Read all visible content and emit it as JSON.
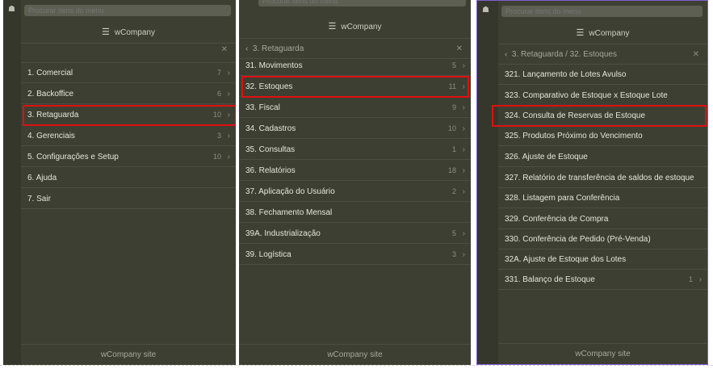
{
  "search_placeholder": "Procurar itens do menu",
  "brand": "wCompany",
  "footer": "wCompany site",
  "panel1": {
    "items": [
      {
        "label": "1. Comercial",
        "count": "7"
      },
      {
        "label": "2. Backoffice",
        "count": "6"
      },
      {
        "label": "3. Retaguarda",
        "count": "10"
      },
      {
        "label": "4. Gerenciais",
        "count": "3"
      },
      {
        "label": "5. Configurações e Setup",
        "count": "10"
      },
      {
        "label": "6. Ajuda",
        "count": ""
      },
      {
        "label": "7. Sair",
        "count": ""
      }
    ]
  },
  "panel2": {
    "search_partial": "Procurar itens do menu",
    "breadcrumb": "3. Retaguarda",
    "items": [
      {
        "label": "31. Movimentos",
        "count": "5"
      },
      {
        "label": "32. Estoques",
        "count": "11"
      },
      {
        "label": "33. Fiscal",
        "count": "9"
      },
      {
        "label": "34. Cadastros",
        "count": "10"
      },
      {
        "label": "35. Consultas",
        "count": "1"
      },
      {
        "label": "36. Relatórios",
        "count": "18"
      },
      {
        "label": "37. Aplicação do Usuário",
        "count": "2"
      },
      {
        "label": "38. Fechamento Mensal",
        "count": ""
      },
      {
        "label": "39A. Industrialização",
        "count": "5"
      },
      {
        "label": "39. Logística",
        "count": "3"
      }
    ]
  },
  "panel3": {
    "breadcrumb": "3. Retaguarda / 32. Estoques",
    "items": [
      {
        "label": "321. Lançamento de Lotes Avulso",
        "count": ""
      },
      {
        "label": "323. Comparativo de Estoque x Estoque Lote",
        "count": ""
      },
      {
        "label": "324. Consulta de Reservas de Estoque",
        "count": ""
      },
      {
        "label": "325. Produtos Próximo do Vencimento",
        "count": ""
      },
      {
        "label": "326. Ajuste de Estoque",
        "count": ""
      },
      {
        "label": "327. Relatório de transferência de saldos de estoque",
        "count": ""
      },
      {
        "label": "328. Listagem para Conferência",
        "count": ""
      },
      {
        "label": "329. Conferência de Compra",
        "count": ""
      },
      {
        "label": "330. Conferência de Pedido (Pré-Venda)",
        "count": ""
      },
      {
        "label": "32A. Ajuste de Estoque dos Lotes",
        "count": ""
      },
      {
        "label": "331. Balanço de Estoque",
        "count": "1"
      }
    ]
  },
  "icons": {
    "home": "home-icon",
    "hamburger": "hamburger-icon",
    "close": "close-icon",
    "back": "chevron-left-icon",
    "chevron": "chevron-right-icon"
  },
  "colors": {
    "panel_bg": "#3d3f33",
    "highlight": "#e01010",
    "active_border": "#7f5fd0"
  }
}
